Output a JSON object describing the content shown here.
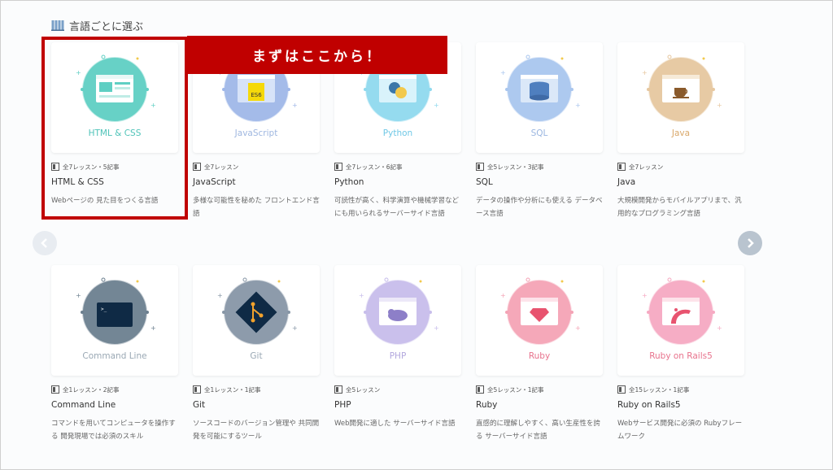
{
  "section": {
    "title": "言語ごとに選ぶ"
  },
  "banner": {
    "text": "まずはここから！"
  },
  "colors": {
    "accent": "#c00000",
    "nav_next": "#b9c4cf",
    "nav_prev": "#e8ecf1"
  },
  "courses": [
    {
      "key": "html",
      "thumb_label": "HTML & CSS",
      "meta": "全7レッスン・5記事",
      "name": "HTML & CSS",
      "desc": "Webページの 見た目をつくる言語",
      "color": "#5fcfc3",
      "label_color": "#4fc3b8",
      "icon": "webpage-icon"
    },
    {
      "key": "js",
      "thumb_label": "JavaScript",
      "meta": "全7レッスン",
      "name": "JavaScript",
      "desc": "多様な可能性を秘めた フロントエンド言語",
      "color": "#9fb7e8",
      "label_color": "#9fb7e0",
      "icon": "es6-icon",
      "icon_text": "ES6"
    },
    {
      "key": "python",
      "thumb_label": "Python",
      "meta": "全7レッスン・6記事",
      "name": "Python",
      "desc": "可読性が高く、科学演算や機械学習などにも用いられるサーバーサイド言語",
      "color": "#8fd9ee",
      "label_color": "#6fc8e6",
      "icon": "python-icon"
    },
    {
      "key": "sql",
      "thumb_label": "SQL",
      "meta": "全5レッスン・3記事",
      "name": "SQL",
      "desc": "データの操作や分析にも使える データベース言語",
      "color": "#a9c6ee",
      "label_color": "#9ab6e0",
      "icon": "database-icon"
    },
    {
      "key": "java",
      "thumb_label": "Java",
      "meta": "全7レッスン",
      "name": "Java",
      "desc": "大規模開発からモバイルアプリまで、汎用的なプログラミング言語",
      "color": "#e6c79f",
      "label_color": "#d9a86a",
      "icon": "coffee-cup-icon"
    },
    {
      "key": "cmd",
      "thumb_label": "Command Line",
      "meta": "全1レッスン・2記事",
      "name": "Command Line",
      "desc": "コマンドを用いてコンピュータを操作する 開発現場では必須のスキル",
      "color": "#6c7f8f",
      "label_color": "#9aa8b4",
      "icon": "terminal-icon"
    },
    {
      "key": "git",
      "thumb_label": "Git",
      "meta": "全1レッスン・1記事",
      "name": "Git",
      "desc": "ソースコードのバージョン管理や 共同開発を可能にするツール",
      "color": "#8796a6",
      "label_color": "#9aa8b4",
      "icon": "git-icon"
    },
    {
      "key": "php",
      "thumb_label": "PHP",
      "meta": "全5レッスン",
      "name": "PHP",
      "desc": "Web開発に適した サーバーサイド言語",
      "color": "#c7bdeb",
      "label_color": "#b3a8de",
      "icon": "elephant-icon"
    },
    {
      "key": "ruby",
      "thumb_label": "Ruby",
      "meta": "全5レッスン・1記事",
      "name": "Ruby",
      "desc": "直感的に理解しやすく、高い生産性を誇る サーバーサイド言語",
      "color": "#f4a3b5",
      "label_color": "#e8738d",
      "icon": "ruby-gem-icon"
    },
    {
      "key": "rails",
      "thumb_label": "Ruby on Rails5",
      "meta": "全15レッスン・1記事",
      "name": "Ruby on Rails5",
      "desc": "Webサービス開発に必須の Rubyフレームワーク",
      "color": "#f6a9c2",
      "label_color": "#e8738d",
      "icon": "rails-icon"
    }
  ]
}
